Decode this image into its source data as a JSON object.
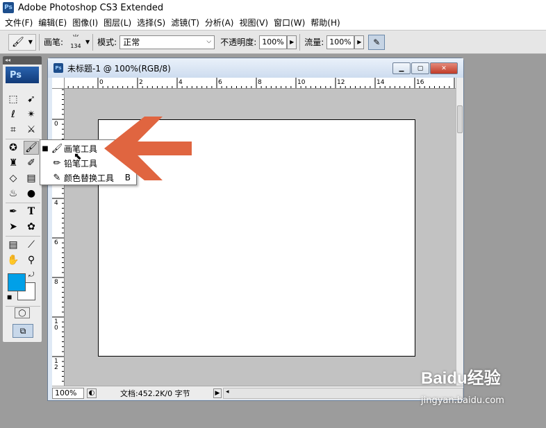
{
  "app": {
    "logo": "Ps",
    "title": "Adobe Photoshop CS3 Extended"
  },
  "menu": [
    "文件(F)",
    "编辑(E)",
    "图像(I)",
    "图层(L)",
    "选择(S)",
    "滤镜(T)",
    "分析(A)",
    "视图(V)",
    "窗口(W)",
    "帮助(H)"
  ],
  "options": {
    "brush_label": "画笔:",
    "brush_size": "134",
    "mode_label": "模式:",
    "mode_value": "正常",
    "opacity_label": "不透明度:",
    "opacity_value": "100%",
    "flow_label": "流量:",
    "flow_value": "100%"
  },
  "toolbox": {
    "grip": "◂◂",
    "logo": "Ps"
  },
  "document": {
    "title": "未标题-1 @ 100%(RGB/8)",
    "ruler_top": [
      "0",
      "2",
      "4",
      "6",
      "8",
      "10",
      "12",
      "14",
      "16"
    ],
    "ruler_left": [
      "0",
      "2",
      "4",
      "6",
      "8",
      "10",
      "12"
    ],
    "zoom": "100%",
    "status": "文档:452.2K/0 字节"
  },
  "popup": {
    "items": [
      {
        "label": "画笔工具",
        "shortcut": "",
        "selected": true
      },
      {
        "label": "铅笔工具",
        "shortcut": "",
        "selected": false
      },
      {
        "label": "颜色替换工具",
        "shortcut": "B",
        "selected": false
      }
    ]
  },
  "colors": {
    "foreground": "#00a0e8",
    "background": "#ffffff",
    "arrow": "#e06540"
  },
  "watermark": {
    "main": "Baidu经验",
    "sub": "jingyan.baidu.com"
  }
}
